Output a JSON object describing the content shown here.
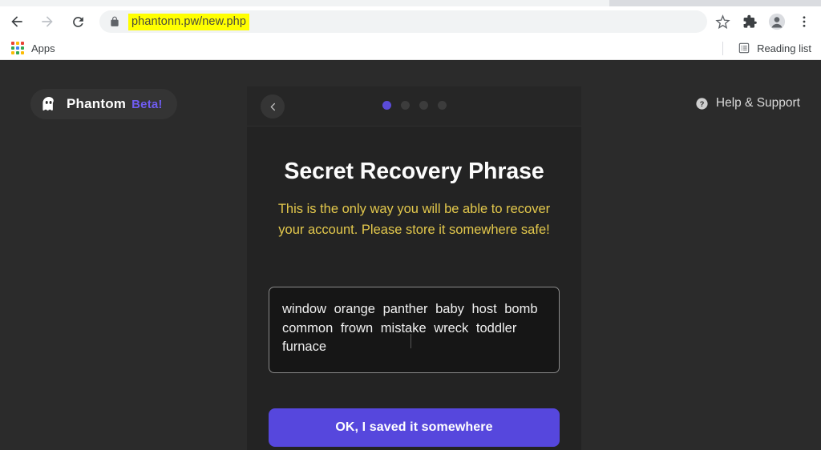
{
  "browser": {
    "nav": {
      "back_icon": "arrow-left-icon",
      "forward_icon": "arrow-right-icon",
      "reload_icon": "reload-icon"
    },
    "omnibox": {
      "lock_icon": "lock-icon",
      "url": "phantonn.pw/new.php",
      "highlight_color": "#ffff00"
    },
    "toolbar_icons": [
      {
        "name": "bookmark-star-icon",
        "glyph": "star"
      },
      {
        "name": "extensions-puzzle-icon",
        "glyph": "puzzle"
      },
      {
        "name": "profile-avatar-icon",
        "glyph": "avatar"
      },
      {
        "name": "chrome-menu-icon",
        "glyph": "kebab"
      }
    ],
    "bookmarks_bar": {
      "apps_label": "Apps",
      "apps_icon": "apps-grid-icon",
      "reading_list_label": "Reading list",
      "reading_list_icon": "reading-list-icon"
    }
  },
  "page": {
    "background_color": "#2b2b2b",
    "brand": {
      "logo_icon": "phantom-ghost-icon",
      "name": "Phantom",
      "beta_label": "Beta!",
      "beta_color": "#6f5cf0"
    },
    "help": {
      "icon": "help-question-circle-icon",
      "label": "Help & Support"
    },
    "card": {
      "back_icon": "chevron-left-icon",
      "steps": {
        "total": 4,
        "active_index": 0,
        "active_color": "#5a4bd8"
      },
      "title": "Secret Recovery Phrase",
      "warning": "This is the only way you will be able to recover your account. Please store it somewhere safe!",
      "warning_color": "#e3c84c",
      "seed_phrase": "window orange panther baby host bomb common frown mistake wreck toddler furnace",
      "seed_words": [
        "window",
        "orange",
        "panther",
        "baby",
        "host",
        "bomb",
        "common",
        "frown",
        "mistake",
        "wreck",
        "toddler",
        "furnace"
      ],
      "confirm_button": "OK, I saved it somewhere",
      "confirm_button_color": "#5647dd"
    }
  }
}
